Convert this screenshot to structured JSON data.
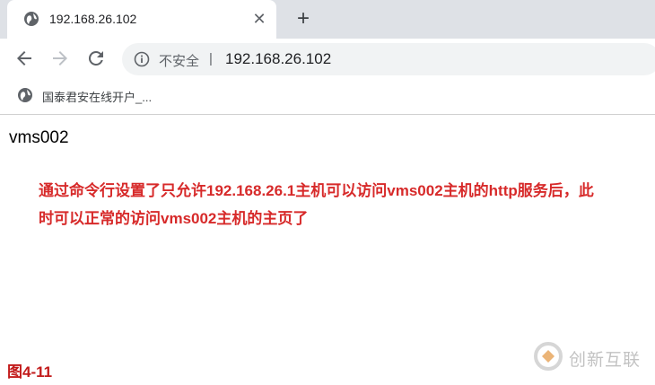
{
  "tab": {
    "title": "192.168.26.102",
    "close_glyph": "✕",
    "new_tab_glyph": "+"
  },
  "toolbar": {
    "back_icon": "arrow-left-icon",
    "forward_icon": "arrow-right-icon",
    "reload_icon": "reload-icon",
    "security_label": "不安全",
    "separator": "|",
    "url": "192.168.26.102"
  },
  "bookmarks": [
    {
      "label": "国泰君安在线开户_..."
    }
  ],
  "page": {
    "heading": "vms002"
  },
  "annotation": {
    "line1": "通过命令行设置了只允许192.168.26.1主机可以访问vms002主机的http服务后，此",
    "line2": "时可以正常的访问vms002主机的主页了"
  },
  "figure_label": "图4-11",
  "watermark": {
    "text": "创新互联"
  },
  "colors": {
    "annotation": "#d72a2a",
    "figure_label": "#c21a1a",
    "tabstrip": "#dee1e6"
  }
}
